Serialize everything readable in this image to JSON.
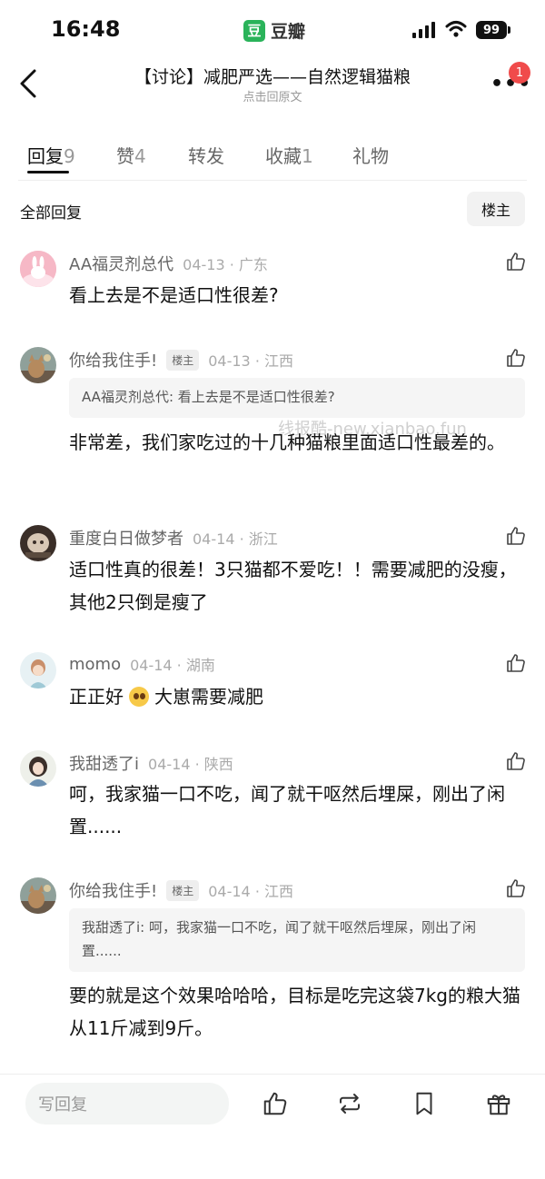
{
  "status_bar": {
    "time": "16:48",
    "app_name": "豆瓣",
    "app_logo": "豆",
    "battery": "99"
  },
  "nav": {
    "title": "【讨论】减肥严选——自然逻辑猫粮",
    "subtitle": "点击回原文",
    "more_label": "•••",
    "notification_count": "1"
  },
  "tabs": [
    {
      "label": "回复",
      "count": "9"
    },
    {
      "label": "赞",
      "count": "4"
    },
    {
      "label": "转发",
      "count": ""
    },
    {
      "label": "收藏",
      "count": "1"
    },
    {
      "label": "礼物",
      "count": ""
    }
  ],
  "filter": {
    "all_label": "全部回复",
    "op_label": "楼主"
  },
  "watermark": "线报酷-new.xianbao.fun",
  "comments": [
    {
      "user": "AA福灵剂总代",
      "badge": "",
      "date": "04-13 · 广东",
      "text": "看上去是不是适口性很差?"
    },
    {
      "user": "你给我住手!",
      "badge": "楼主",
      "date": "04-13 · 江西",
      "quote": "AA福灵剂总代: 看上去是不是适口性很差?",
      "text": "非常差，我们家吃过的十几种猫粮里面适口性最差的。"
    },
    {
      "user": "重度白日做梦者",
      "badge": "",
      "date": "04-14 · 浙江",
      "text": "适口性真的很差！3只猫都不爱吃！！需要减肥的没瘦，其他2只倒是瘦了"
    },
    {
      "user": "momo",
      "badge": "",
      "date": "04-14 · 湖南",
      "text_before": "正正好",
      "text_after": "大崽需要减肥",
      "emoji": "pleading-face-emoji"
    },
    {
      "user": "我甜透了i",
      "badge": "",
      "date": "04-14 · 陕西",
      "text": "呵，我家猫一口不吃，闻了就干呕然后埋屎，刚出了闲置......"
    },
    {
      "user": "你给我住手!",
      "badge": "楼主",
      "date": "04-14 · 江西",
      "quote": "我甜透了i: 呵，我家猫一口不吃，闻了就干呕然后埋屎，刚出了闲置......",
      "text": "要的就是这个效果哈哈哈，目标是吃完这袋7kg的粮大猫从11斤减到9斤。"
    }
  ],
  "bottom_bar": {
    "reply_placeholder": "写回复"
  },
  "colors": {
    "brand_green": "#2ab35a",
    "notification_red": "#f04b4b"
  }
}
